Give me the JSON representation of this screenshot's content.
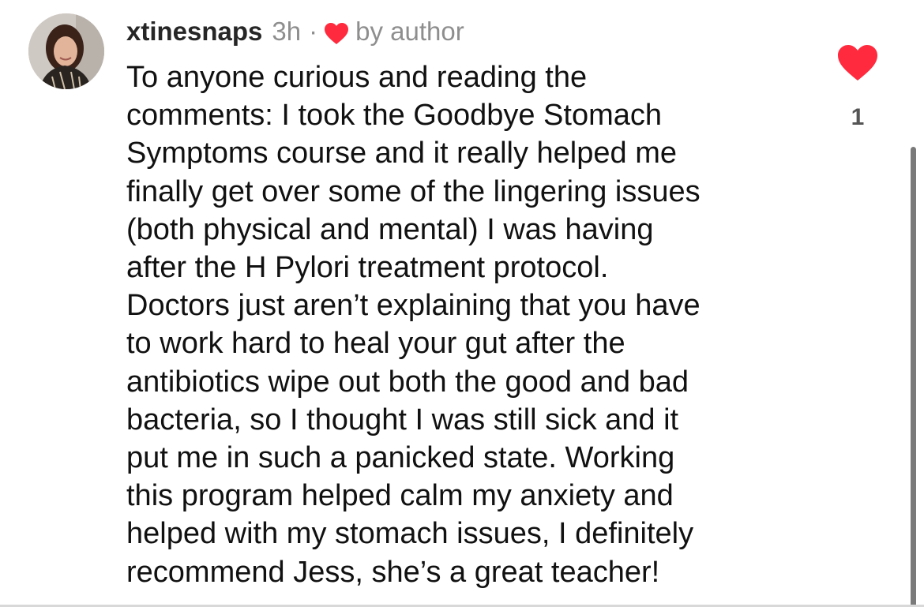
{
  "comment": {
    "username": "xtinesnaps",
    "time": "3h",
    "separator": "·",
    "liked_by_author_label": "by author",
    "text": "To anyone curious and reading the\ncomments: I took the Goodbye Stomach\nSymptoms course and it really helped me\nfinally get over some of the lingering issues\n(both physical and mental) I was having\nafter the H Pylori treatment protocol.\nDoctors just aren’t explaining that you have\nto work hard to heal your gut after the\nantibiotics wipe out both the good and bad\nbacteria, so I thought I was still sick and it\nput me in such a panicked state. Working\nthis program helped calm my anxiety and\nhelped with my stomach issues, I definitely\nrecommend Jess, she’s a great teacher!",
    "like_count": "1",
    "liked": true
  },
  "icons": {
    "avatar": "profile-photo",
    "author_heart": "heart-filled-icon",
    "like": "heart-filled-icon"
  },
  "colors": {
    "heart": "#ff2a3d",
    "muted_text": "#8e8e8e",
    "like_count": "#555555",
    "scrollbar": "#7a7a7a"
  }
}
